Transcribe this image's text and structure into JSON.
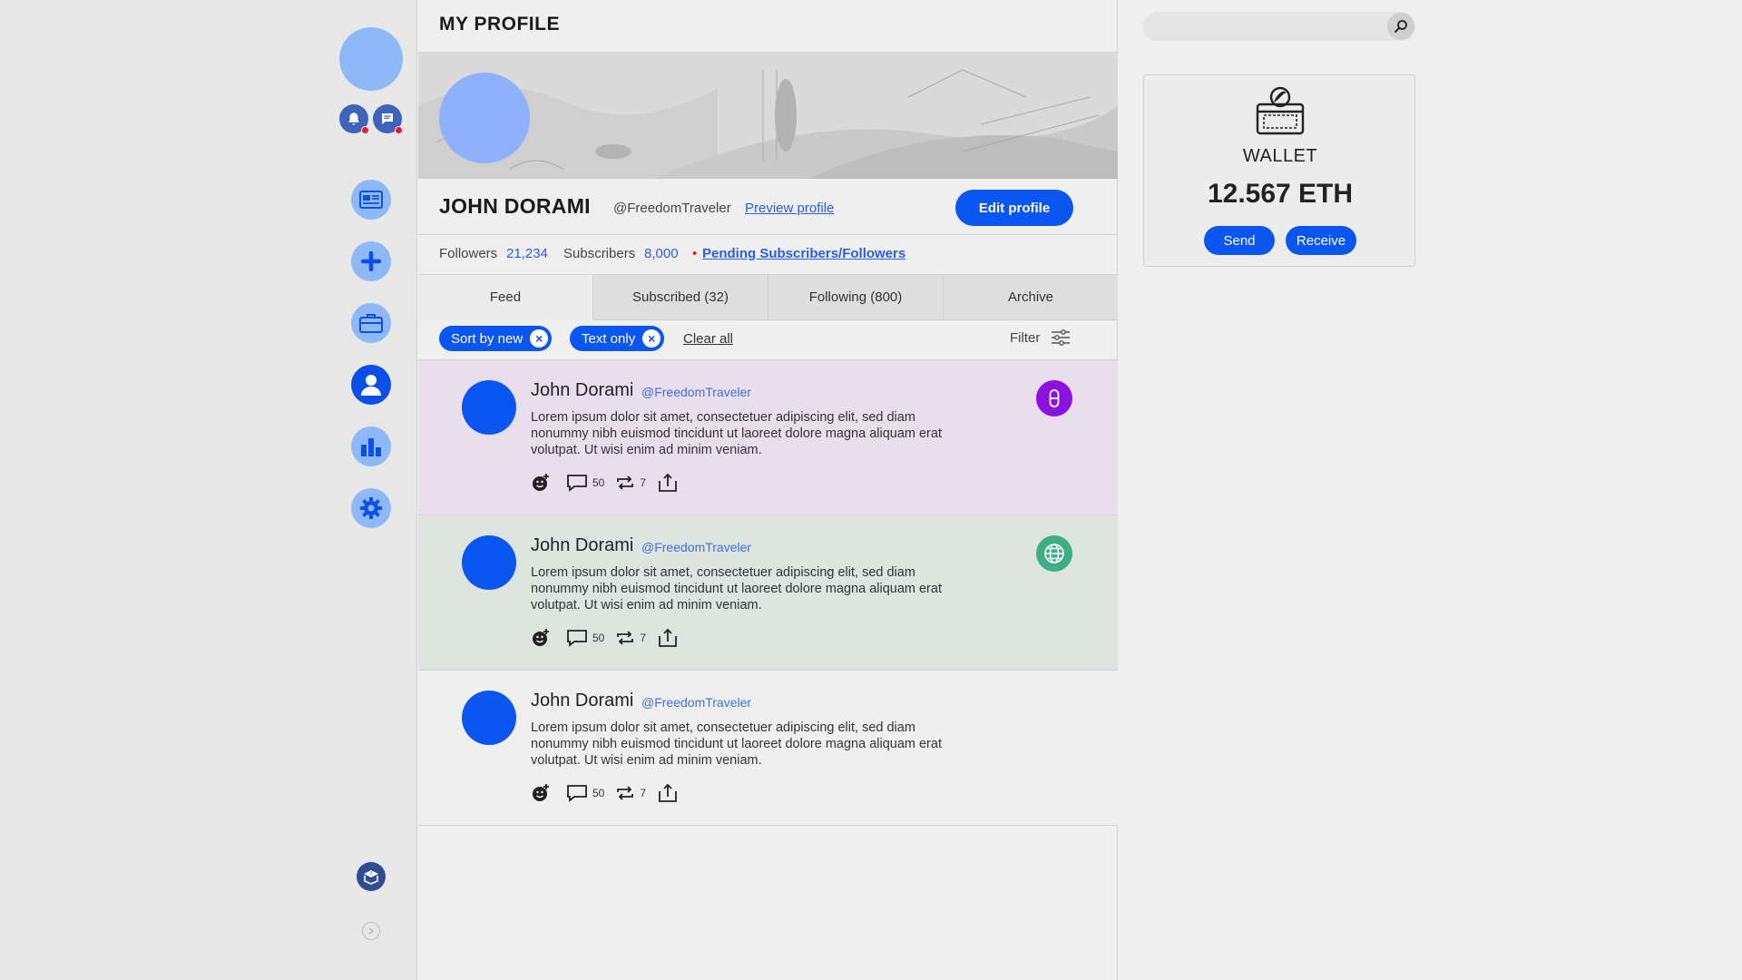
{
  "page": {
    "title": "MY PROFILE"
  },
  "sidebar": {
    "mini_icons": [
      "bell-icon",
      "chat-icon"
    ],
    "nav": [
      {
        "icon": "newspaper-icon",
        "active": false
      },
      {
        "icon": "plus-icon",
        "active": false
      },
      {
        "icon": "briefcase-icon",
        "active": false
      },
      {
        "icon": "user-icon",
        "active": true
      },
      {
        "icon": "bar-chart-icon",
        "active": false
      },
      {
        "icon": "gear-icon",
        "active": false
      }
    ],
    "bottom_icons": [
      "help-book-icon",
      "chevron-right-icon"
    ]
  },
  "profile": {
    "name": "JOHN DORAMI",
    "handle": "@FreedomTraveler",
    "preview_link": "Preview profile",
    "edit_button": "Edit profile",
    "followers_label": "Followers",
    "followers_value": "21,234",
    "subscribers_label": "Subscribers",
    "subscribers_value": "8,000",
    "pending_dot": "•",
    "pending_link": "Pending Subscribers/Followers"
  },
  "tabs": [
    {
      "label": "Feed",
      "active": true
    },
    {
      "label": "Subscribed  (32)",
      "active": false
    },
    {
      "label": "Following  (800)",
      "active": false
    },
    {
      "label": "Archive",
      "active": false
    }
  ],
  "filters": {
    "chips": [
      "Sort by new",
      "Text only"
    ],
    "chip_close": "×",
    "clear_all": "Clear all",
    "filter_label": "Filter"
  },
  "posts": [
    {
      "author": "John Dorami",
      "handle": "@FreedomTraveler",
      "body": "Lorem ipsum dolor sit amet, consectetuer adipiscing elit, sed diam nonummy nibh euismod tincidunt ut laoreet dolore magna aliquam erat volutpat. Ut wisi enim ad minim veniam.",
      "comments": "50",
      "reposts": "7",
      "background": "#e8deed",
      "badge": {
        "icon": "pill-icon",
        "color": "#8b12e0"
      }
    },
    {
      "author": "John Dorami",
      "handle": "@FreedomTraveler",
      "body": "Lorem ipsum dolor sit amet, consectetuer adipiscing elit, sed diam nonummy nibh euismod tincidunt ut laoreet dolore magna aliquam erat volutpat. Ut wisi enim ad minim veniam.",
      "comments": "50",
      "reposts": "7",
      "background": "#dde5e1",
      "badge": {
        "icon": "globe-icon",
        "color": "#3fae86"
      }
    },
    {
      "author": "John Dorami",
      "handle": "@FreedomTraveler",
      "body": "Lorem ipsum dolor sit amet, consectetuer adipiscing elit, sed diam nonummy nibh euismod tincidunt ut laoreet dolore magna aliquam erat volutpat. Ut wisi enim ad minim veniam.",
      "comments": "50",
      "reposts": "7",
      "background": "#efefef",
      "badge": null
    }
  ],
  "search": {
    "placeholder": ""
  },
  "wallet": {
    "title": "WALLET",
    "amount": "12.567 ETH",
    "send": "Send",
    "receive": "Receive"
  },
  "colors": {
    "accent": "#0b55f0",
    "light_accent": "#8fb8f8",
    "link": "#2a5de0",
    "notification": "#e0202c"
  }
}
